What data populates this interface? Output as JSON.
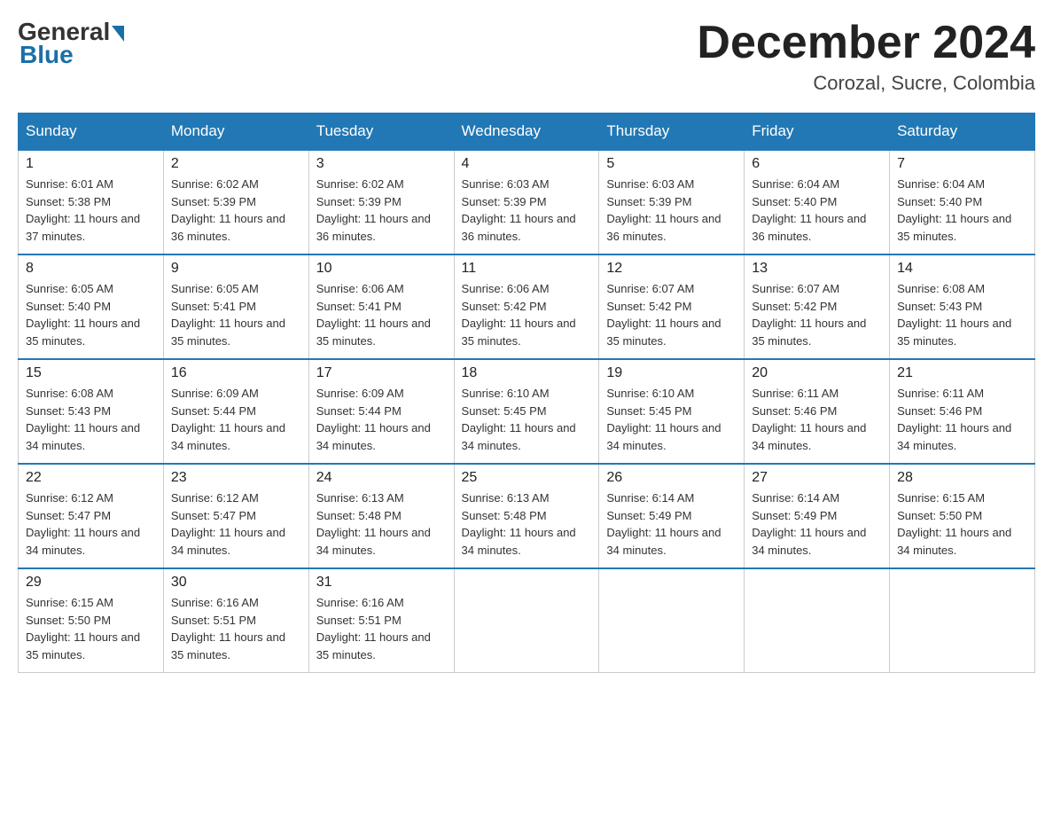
{
  "logo": {
    "general": "General",
    "blue": "Blue"
  },
  "header": {
    "month_year": "December 2024",
    "location": "Corozal, Sucre, Colombia"
  },
  "weekdays": [
    "Sunday",
    "Monday",
    "Tuesday",
    "Wednesday",
    "Thursday",
    "Friday",
    "Saturday"
  ],
  "weeks": [
    [
      {
        "day": "1",
        "sunrise": "6:01 AM",
        "sunset": "5:38 PM",
        "daylight": "11 hours and 37 minutes."
      },
      {
        "day": "2",
        "sunrise": "6:02 AM",
        "sunset": "5:39 PM",
        "daylight": "11 hours and 36 minutes."
      },
      {
        "day": "3",
        "sunrise": "6:02 AM",
        "sunset": "5:39 PM",
        "daylight": "11 hours and 36 minutes."
      },
      {
        "day": "4",
        "sunrise": "6:03 AM",
        "sunset": "5:39 PM",
        "daylight": "11 hours and 36 minutes."
      },
      {
        "day": "5",
        "sunrise": "6:03 AM",
        "sunset": "5:39 PM",
        "daylight": "11 hours and 36 minutes."
      },
      {
        "day": "6",
        "sunrise": "6:04 AM",
        "sunset": "5:40 PM",
        "daylight": "11 hours and 36 minutes."
      },
      {
        "day": "7",
        "sunrise": "6:04 AM",
        "sunset": "5:40 PM",
        "daylight": "11 hours and 35 minutes."
      }
    ],
    [
      {
        "day": "8",
        "sunrise": "6:05 AM",
        "sunset": "5:40 PM",
        "daylight": "11 hours and 35 minutes."
      },
      {
        "day": "9",
        "sunrise": "6:05 AM",
        "sunset": "5:41 PM",
        "daylight": "11 hours and 35 minutes."
      },
      {
        "day": "10",
        "sunrise": "6:06 AM",
        "sunset": "5:41 PM",
        "daylight": "11 hours and 35 minutes."
      },
      {
        "day": "11",
        "sunrise": "6:06 AM",
        "sunset": "5:42 PM",
        "daylight": "11 hours and 35 minutes."
      },
      {
        "day": "12",
        "sunrise": "6:07 AM",
        "sunset": "5:42 PM",
        "daylight": "11 hours and 35 minutes."
      },
      {
        "day": "13",
        "sunrise": "6:07 AM",
        "sunset": "5:42 PM",
        "daylight": "11 hours and 35 minutes."
      },
      {
        "day": "14",
        "sunrise": "6:08 AM",
        "sunset": "5:43 PM",
        "daylight": "11 hours and 35 minutes."
      }
    ],
    [
      {
        "day": "15",
        "sunrise": "6:08 AM",
        "sunset": "5:43 PM",
        "daylight": "11 hours and 34 minutes."
      },
      {
        "day": "16",
        "sunrise": "6:09 AM",
        "sunset": "5:44 PM",
        "daylight": "11 hours and 34 minutes."
      },
      {
        "day": "17",
        "sunrise": "6:09 AM",
        "sunset": "5:44 PM",
        "daylight": "11 hours and 34 minutes."
      },
      {
        "day": "18",
        "sunrise": "6:10 AM",
        "sunset": "5:45 PM",
        "daylight": "11 hours and 34 minutes."
      },
      {
        "day": "19",
        "sunrise": "6:10 AM",
        "sunset": "5:45 PM",
        "daylight": "11 hours and 34 minutes."
      },
      {
        "day": "20",
        "sunrise": "6:11 AM",
        "sunset": "5:46 PM",
        "daylight": "11 hours and 34 minutes."
      },
      {
        "day": "21",
        "sunrise": "6:11 AM",
        "sunset": "5:46 PM",
        "daylight": "11 hours and 34 minutes."
      }
    ],
    [
      {
        "day": "22",
        "sunrise": "6:12 AM",
        "sunset": "5:47 PM",
        "daylight": "11 hours and 34 minutes."
      },
      {
        "day": "23",
        "sunrise": "6:12 AM",
        "sunset": "5:47 PM",
        "daylight": "11 hours and 34 minutes."
      },
      {
        "day": "24",
        "sunrise": "6:13 AM",
        "sunset": "5:48 PM",
        "daylight": "11 hours and 34 minutes."
      },
      {
        "day": "25",
        "sunrise": "6:13 AM",
        "sunset": "5:48 PM",
        "daylight": "11 hours and 34 minutes."
      },
      {
        "day": "26",
        "sunrise": "6:14 AM",
        "sunset": "5:49 PM",
        "daylight": "11 hours and 34 minutes."
      },
      {
        "day": "27",
        "sunrise": "6:14 AM",
        "sunset": "5:49 PM",
        "daylight": "11 hours and 34 minutes."
      },
      {
        "day": "28",
        "sunrise": "6:15 AM",
        "sunset": "5:50 PM",
        "daylight": "11 hours and 34 minutes."
      }
    ],
    [
      {
        "day": "29",
        "sunrise": "6:15 AM",
        "sunset": "5:50 PM",
        "daylight": "11 hours and 35 minutes."
      },
      {
        "day": "30",
        "sunrise": "6:16 AM",
        "sunset": "5:51 PM",
        "daylight": "11 hours and 35 minutes."
      },
      {
        "day": "31",
        "sunrise": "6:16 AM",
        "sunset": "5:51 PM",
        "daylight": "11 hours and 35 minutes."
      },
      null,
      null,
      null,
      null
    ]
  ]
}
